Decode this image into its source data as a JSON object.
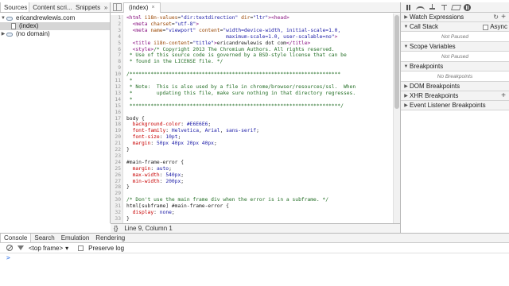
{
  "navigator": {
    "tabs": [
      "Sources",
      "Content scri...",
      "Snippets"
    ],
    "more": "»",
    "tree": [
      {
        "label": "ericandrewlewis.com",
        "expanded": true,
        "icon": "cloud-icon"
      },
      {
        "label": "(index)",
        "selected": true,
        "icon": "file-icon"
      },
      {
        "label": "(no domain)",
        "expanded": false,
        "icon": "cloud-icon"
      }
    ]
  },
  "editor": {
    "tab_label": "(index)",
    "tab_close": "×",
    "gutter": "1\n2\n3\n4\n5\n6\n7\n8\n9\n10\n11\n12\n13\n14\n15\n16\n17\n18\n19\n20\n21\n22\n23\n24\n25\n26\n27\n28\n29\n30\n31\n32\n33",
    "status_braces": "{}",
    "status_text": "Line 9, Column 1"
  },
  "debugger": {
    "sections": [
      {
        "title": "Watch Expressions",
        "expanded": false,
        "action": "+"
      },
      {
        "title": "Call Stack",
        "expanded": true,
        "async_label": "Async",
        "body": "Not Paused"
      },
      {
        "title": "Scope Variables",
        "expanded": true,
        "body": "Not Paused"
      },
      {
        "title": "Breakpoints",
        "expanded": true,
        "body": "No Breakpoints"
      },
      {
        "title": "DOM Breakpoints",
        "expanded": false
      },
      {
        "title": "XHR Breakpoints",
        "expanded": false,
        "action": "+"
      },
      {
        "title": "Event Listener Breakpoints",
        "expanded": false
      }
    ]
  },
  "drawer": {
    "tabs": [
      "Console",
      "Search",
      "Emulation",
      "Rendering"
    ],
    "frame_select": "<top frame>",
    "frame_arrow": "▾",
    "preserve_log": "Preserve log",
    "prompt": ">"
  }
}
